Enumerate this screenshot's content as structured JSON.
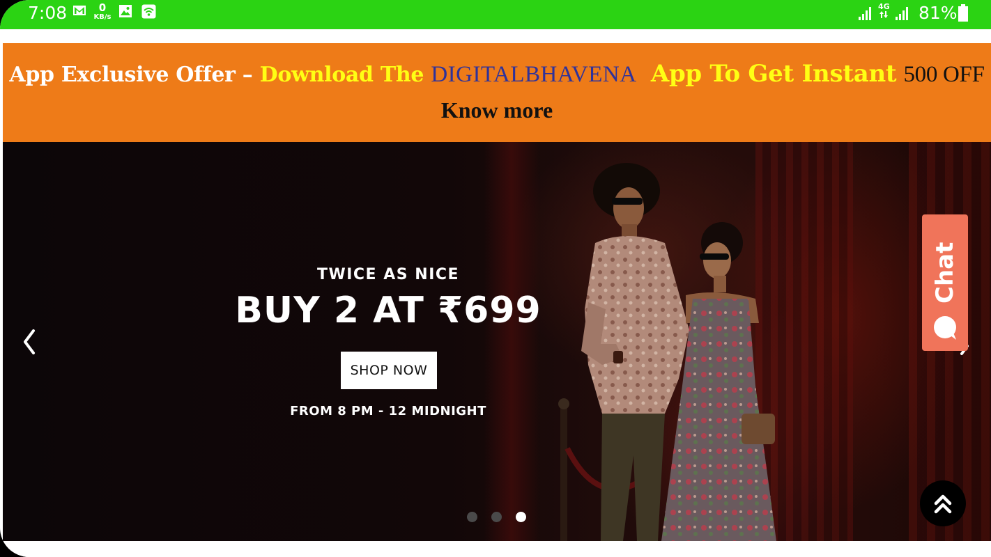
{
  "status_bar": {
    "time": "7:08",
    "speed_value": "0",
    "speed_unit": "KB/s",
    "network_type": "4G",
    "battery_percent": "81%",
    "icons": [
      "gmail-icon",
      "gallery-icon",
      "wifi-hotspot-icon",
      "signal-icon",
      "battery-icon"
    ],
    "background_color": "#2bd313"
  },
  "offer_banner": {
    "part1": "App Exclusive Offer – ",
    "part2": "Download The ",
    "part3": "DIGITALBHAVENA",
    "part4": "App To Get Instant",
    "part5": "500 OFF",
    "know_more": "Know more",
    "background_color": "#ee7b18"
  },
  "hero": {
    "subtitle": "TWICE AS NICE",
    "title": "BUY 2 AT ₹699",
    "button_label": "SHOP NOW",
    "time_text": "FROM 8 PM - 12 MIDNIGHT",
    "slides_total": 3,
    "active_slide": 3
  },
  "chat": {
    "label": "Chat",
    "background_color": "#f0745a"
  },
  "scroll_top": {
    "icon": "double-chevron-up-icon"
  }
}
